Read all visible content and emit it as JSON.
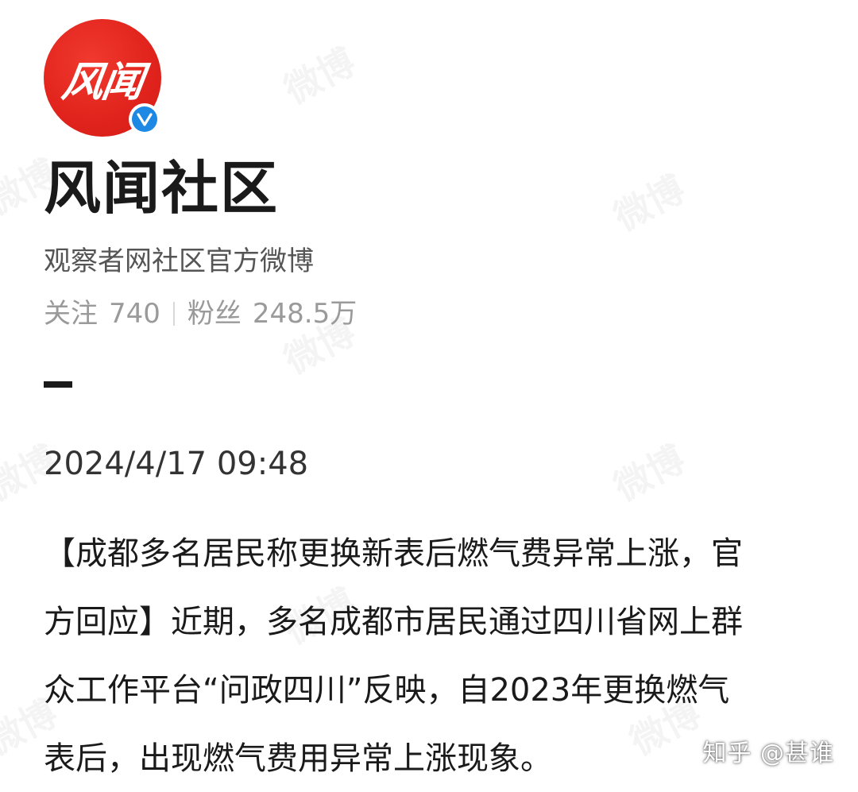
{
  "watermark": "微博",
  "profile": {
    "avatar_text": "风闻",
    "name": "风闻社区",
    "description": "观察者网社区官方微博",
    "stats": {
      "following_label": "关注",
      "following_count": "740",
      "followers_label": "粉丝",
      "followers_count": "248.5万"
    },
    "verified_icon": "verified-v-icon",
    "accent_color": "#e0231c",
    "verified_color": "#1e88e5"
  },
  "post": {
    "datetime": "2024/4/17 09:48",
    "lines": [
      "【成都多名居民称更换新表后燃气费异常上涨，官",
      "方回应】近期，多名成都市居民通过四川省网上群",
      "众工作平台“问政四川”反映，自2023年更换燃气",
      "表后，出现燃气费用异常上涨现象。"
    ]
  },
  "source_mark": "知乎 @甚谁"
}
